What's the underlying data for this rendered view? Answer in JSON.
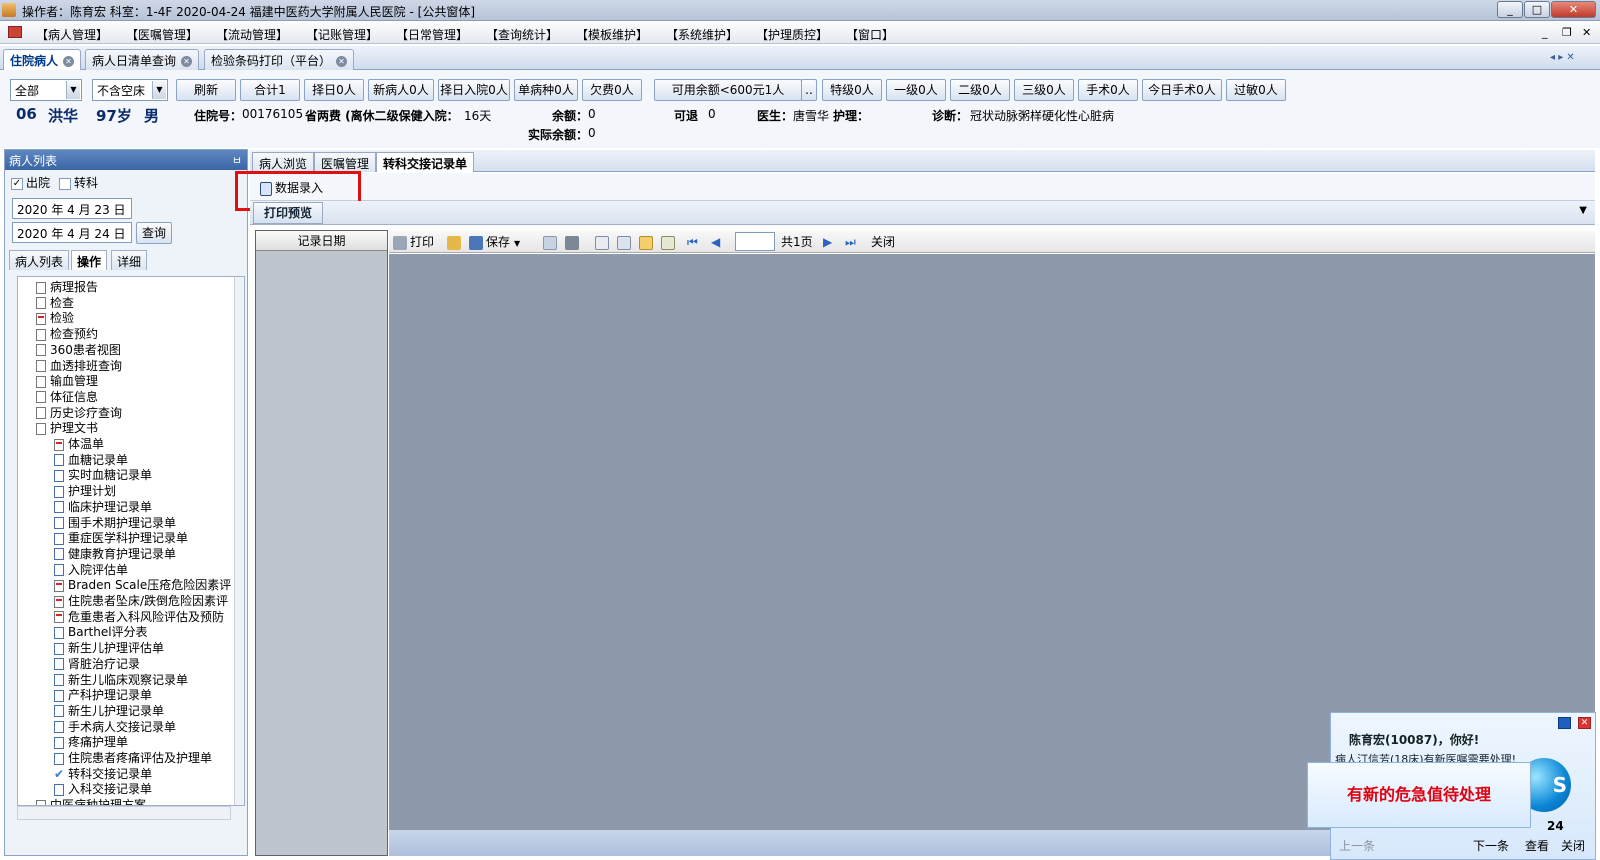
{
  "window": {
    "title": "操作者：陈育宏  科室：1-4F  2020-04-24  福建中医药大学附属人民医院 - [公共窗体]",
    "min_label": "_",
    "max_label": "□",
    "close_label": "✕"
  },
  "menu": {
    "items": [
      "【病人管理】",
      "【医嘱管理】",
      "【流动管理】",
      "【记账管理】",
      "【日常管理】",
      "【查询统计】",
      "【模板维护】",
      "【系统维护】",
      "【护理质控】",
      "【窗口】"
    ],
    "mdi_min": "_",
    "mdi_restore": "❐",
    "mdi_close": "✕"
  },
  "doc_tabs": [
    "住院病人",
    "病人日清单查询",
    "检验条码打印（平台）"
  ],
  "doc_tab_nav": "◂ ▸ ✕",
  "toolbar": {
    "filter1": "全部",
    "filter2": "不含空床",
    "buttons": [
      "刷新",
      "合计1",
      "择日0人",
      "新病人0人",
      "择日入院0人",
      "单病种0人",
      "欠费0人"
    ],
    "balance_button": "可用余额<600元1人",
    "balance_more": "..",
    "level_buttons": [
      "特级0人",
      "一级0人",
      "二级0人",
      "三级0人",
      "手术0人",
      "今日手术0人",
      "过敏0人"
    ]
  },
  "patient": {
    "bed": "06",
    "name": "洪华",
    "age": "97岁",
    "sex": "男",
    "admission_no_label": "住院号：",
    "admission_no": "00176105",
    "insurance": "省两费 (离休二级保健入院：",
    "days": "16天",
    "balance_label": "余额：",
    "balance": "0",
    "actual_balance_label": "实际余额：",
    "actual_balance": "0",
    "refundable_label": "可退",
    "refundable": "0",
    "doctor_label": "医生：",
    "doctor": "唐雪华",
    "nurse_label": "护理：",
    "diagnosis_label": "诊断：",
    "diagnosis": "冠状动脉粥样硬化性心脏病"
  },
  "left_panel": {
    "title": "病人列表",
    "pin": "ㅂ",
    "discharged_label": "出院",
    "discharged_checked": "✓",
    "transfer_label": "转科",
    "date_from": "2020 年 4 月 23 日",
    "date_to": "2020 年 4 月 24 日",
    "query_button": "查询",
    "tabs": [
      "病人列表",
      "操作",
      "详细"
    ],
    "tree": [
      {
        "label": "病理报告",
        "level": 1,
        "icon": "doc"
      },
      {
        "label": "检查",
        "level": 1,
        "icon": "search"
      },
      {
        "label": "检验",
        "level": 1,
        "icon": "red"
      },
      {
        "label": "检查预约",
        "level": 1,
        "icon": "doc"
      },
      {
        "label": "360患者视图",
        "level": 1,
        "icon": "doc"
      },
      {
        "label": "血透排班查询",
        "level": 1,
        "icon": "doc"
      },
      {
        "label": "输血管理",
        "level": 1,
        "icon": "doc"
      },
      {
        "label": "体征信息",
        "level": 1,
        "icon": "doc"
      },
      {
        "label": "历史诊疗查询",
        "level": 1,
        "icon": "doc"
      },
      {
        "label": "护理文书",
        "level": 1,
        "icon": "folder"
      },
      {
        "label": "体温单",
        "level": 2,
        "icon": "red"
      },
      {
        "label": "血糖记录单",
        "level": 2,
        "icon": "blue"
      },
      {
        "label": "实时血糖记录单",
        "level": 2,
        "icon": "blue"
      },
      {
        "label": "护理计划",
        "level": 2,
        "icon": "blue"
      },
      {
        "label": "临床护理记录单",
        "level": 2,
        "icon": "blue"
      },
      {
        "label": "围手术期护理记录单",
        "level": 2,
        "icon": "blue"
      },
      {
        "label": "重症医学科护理记录单",
        "level": 2,
        "icon": "blue"
      },
      {
        "label": "健康教育护理记录单",
        "level": 2,
        "icon": "blue"
      },
      {
        "label": "入院评估单",
        "level": 2,
        "icon": "blue"
      },
      {
        "label": "Braden Scale压疮危险因素评",
        "level": 2,
        "icon": "red"
      },
      {
        "label": "住院患者坠床/跌倒危险因素评",
        "level": 2,
        "icon": "red"
      },
      {
        "label": "危重患者入科风险评估及预防",
        "level": 2,
        "icon": "red"
      },
      {
        "label": "Barthel评分表",
        "level": 2,
        "icon": "blue"
      },
      {
        "label": "新生儿护理评估单",
        "level": 2,
        "icon": "blue"
      },
      {
        "label": "肾脏治疗记录",
        "level": 2,
        "icon": "blue"
      },
      {
        "label": "新生儿临床观察记录单",
        "level": 2,
        "icon": "blue"
      },
      {
        "label": "产科护理记录单",
        "level": 2,
        "icon": "blue"
      },
      {
        "label": "新生儿护理记录单",
        "level": 2,
        "icon": "blue"
      },
      {
        "label": "手术病人交接记录单",
        "level": 2,
        "icon": "blue"
      },
      {
        "label": "疼痛护理单",
        "level": 2,
        "icon": "blue"
      },
      {
        "label": "住院患者疼痛评估及护理单",
        "level": 2,
        "icon": "blue"
      },
      {
        "label": "转科交接记录单",
        "level": 2,
        "icon": "check"
      },
      {
        "label": "入科交接记录单",
        "level": 2,
        "icon": "blue"
      },
      {
        "label": "中医病种护理方案",
        "level": 1,
        "icon": "folder"
      }
    ]
  },
  "right": {
    "tabs": [
      "病人浏览",
      "医嘱管理",
      "转科交接记录单"
    ],
    "data_entry": "数据录入",
    "print_preview_tab": "打印预览",
    "record_date_header": "记录日期",
    "pv_toolbar": {
      "print": "打印",
      "save": "保存",
      "total_pages": "共1页",
      "close": "关闭"
    }
  },
  "notification": {
    "greeting": "陈育宏(10087)，你好!",
    "message": "病人汀信芳(18床)有新医嘱需要处理!",
    "globe_text": "S",
    "date_partial": "24",
    "prev": "上一条",
    "next": "下一条",
    "view": "查看",
    "close": "关闭",
    "alert": "有新的危急值待处理"
  }
}
